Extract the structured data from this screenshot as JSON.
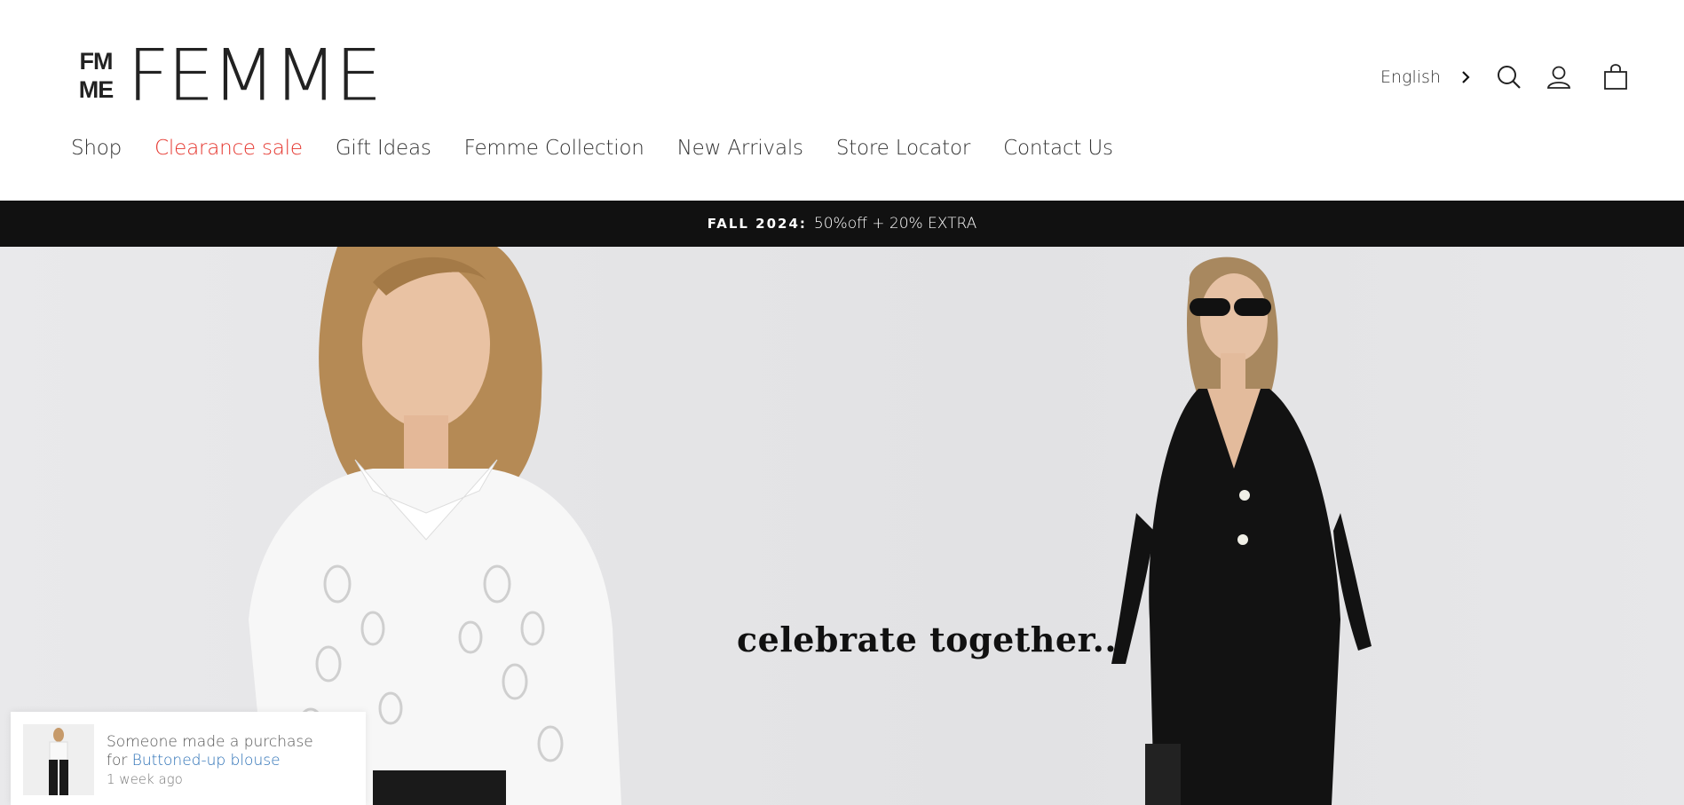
{
  "brand": {
    "mark": [
      "FM",
      "ME"
    ],
    "word": "FEMME"
  },
  "utility": {
    "language": "English"
  },
  "nav": [
    {
      "label": "Shop",
      "sale": false
    },
    {
      "label": "Clearance sale",
      "sale": true
    },
    {
      "label": "Gift Ideas",
      "sale": false
    },
    {
      "label": "Femme Collection",
      "sale": false
    },
    {
      "label": "New Arrivals",
      "sale": false
    },
    {
      "label": "Store Locator",
      "sale": false
    },
    {
      "label": "Contact Us",
      "sale": false
    }
  ],
  "promo": {
    "bold": "FALL 2024:",
    "text": "50%off + 20% EXTRA"
  },
  "hero": {
    "tagline": "celebrate together..."
  },
  "toast": {
    "line1": "Someone made a purchase",
    "for": "for",
    "product": "Buttoned-up blouse",
    "time": "1 week ago"
  },
  "colors": {
    "sale": "#e5352d",
    "promo_bg": "#111111",
    "link": "#2a6fb5"
  },
  "icons": [
    "chevron-right-icon",
    "search-icon",
    "account-icon",
    "cart-icon"
  ]
}
